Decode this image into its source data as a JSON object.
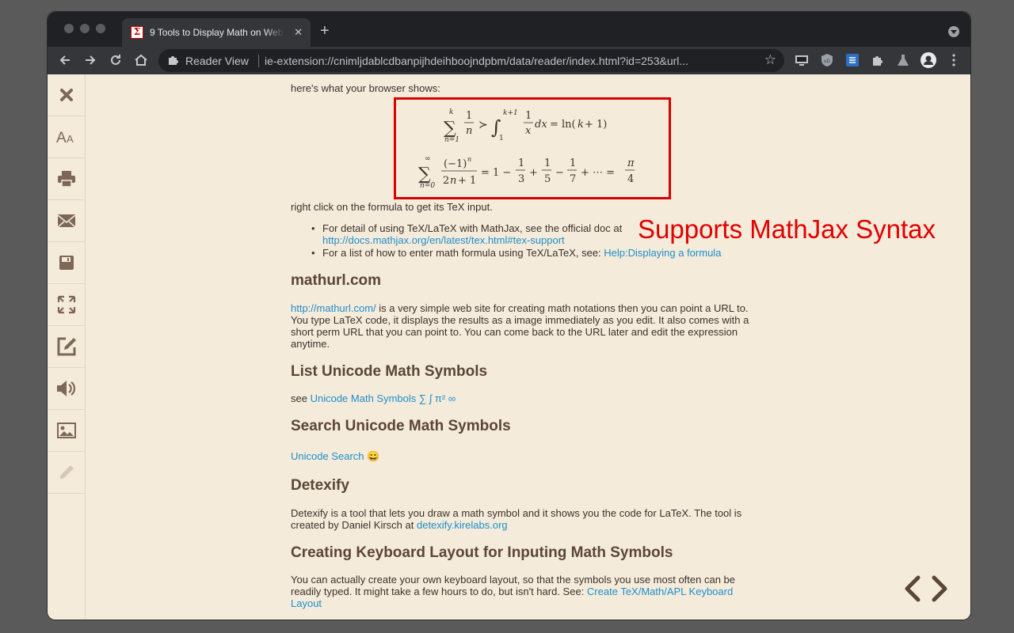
{
  "browser": {
    "tab_title": "9 Tools to Display Math on Web",
    "tab_close": "✕",
    "new_tab": "+",
    "reader_label": "Reader View",
    "url": "ie-extension://cnimljdablcdbanpijhdeihboojndpbm/data/reader/index.html?id=253&url...",
    "star": "☆"
  },
  "sidebar": {
    "items": [
      "close",
      "font-size",
      "print",
      "email",
      "save",
      "fullscreen",
      "edit",
      "speak",
      "images",
      "highlight"
    ]
  },
  "article": {
    "intro": "here's what your browser shows:",
    "math_caption": "right click on the formula to get its TeX input.",
    "bullet1_text": "For detail of using TeX/LaTeX with MathJax, see the official doc at",
    "bullet1_link": "http://docs.mathjax.org/en/latest/tex.html#tex-support",
    "bullet2_text": "For a list of how to enter math formula using TeX/LaTeX, see:",
    "bullet2_link": "Help:Displaying a formula",
    "h_mathurl": "mathurl.com",
    "mathurl_link": "http://mathurl.com/",
    "mathurl_p1": "is a very simple web site for creating math notations then you can point a URL to.",
    "mathurl_p2": "You type LaTeX code, it displays the results as a image immediately as you edit. It also comes with a",
    "mathurl_p3": "short perm URL that you can point to. You can come back to the URL later and edit the expression",
    "mathurl_p4": "anytime.",
    "h_list_unicode": "List Unicode Math Symbols",
    "see_text": "see",
    "unicode_symbols_link": "Unicode Math Symbols ∑ ∫ π² ∞",
    "h_search_unicode": "Search Unicode Math Symbols",
    "unicode_search_link": "Unicode Search",
    "unicode_search_emoji": "😀",
    "h_detexify": "Detexify",
    "detexify_p1": "Detexify is a tool that lets you draw a math symbol and it shows you the code for LaTeX. The tool is",
    "detexify_p2": "created by Daniel Kirsch at",
    "detexify_link": "detexify.kirelabs.org",
    "h_keyboard": "Creating Keyboard Layout for Inputing Math Symbols",
    "keyboard_p1": "You can actually create your own keyboard layout, so that the symbols you use most often can be",
    "keyboard_p2": "readily typed. It might take a few hours to do, but isn't hard. See:",
    "keyboard_link1": "Create TeX/Math/APL Keyboard",
    "keyboard_link2": "Layout"
  },
  "callout": "Supports MathJax Syntax",
  "colors": {
    "callout_red": "#e00000",
    "page_bg": "#f5ebdb",
    "link": "#1d8eca",
    "heading": "#5a4637"
  }
}
